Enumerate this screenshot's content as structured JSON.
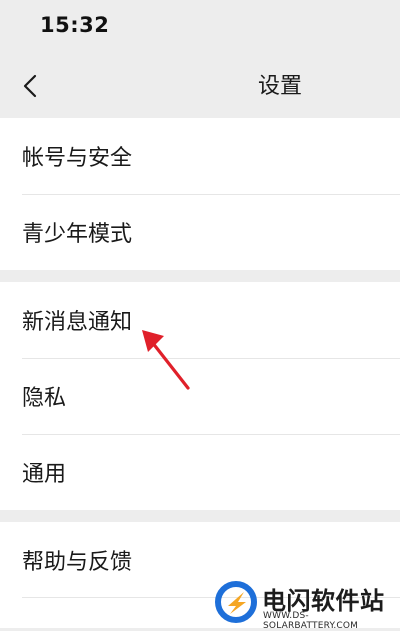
{
  "status_bar": {
    "time": "15:32"
  },
  "nav": {
    "title": "设置",
    "back_icon": "chevron-left-icon"
  },
  "sections": [
    {
      "items": [
        {
          "label": "帐号与安全"
        },
        {
          "label": "青少年模式"
        }
      ]
    },
    {
      "items": [
        {
          "label": "新消息通知"
        },
        {
          "label": "隐私"
        },
        {
          "label": "通用"
        }
      ]
    },
    {
      "items": [
        {
          "label": "帮助与反馈"
        }
      ]
    }
  ],
  "annotation": {
    "color": "#e0202a"
  },
  "watermark": {
    "title": "电闪软件站",
    "url": "WWW.DS-SOLARBATTERY.COM",
    "logo_blue": "#1e6fd9",
    "logo_orange": "#f5a623"
  }
}
